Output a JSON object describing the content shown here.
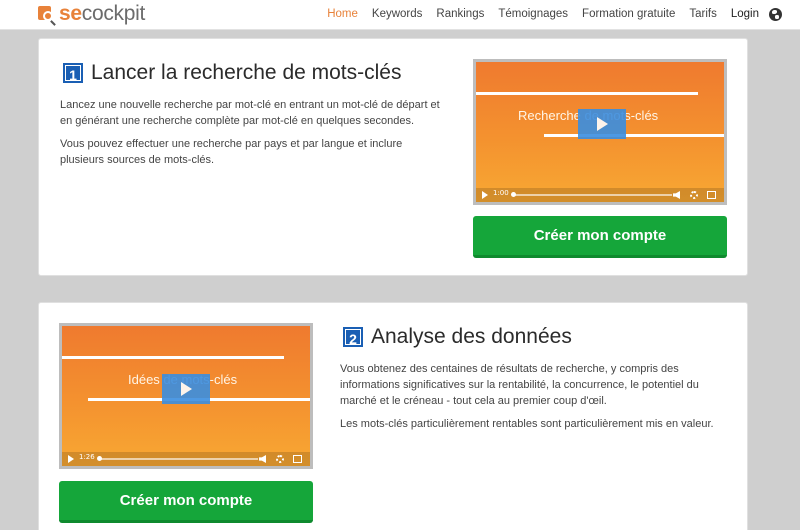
{
  "header": {
    "logo_se": "se",
    "logo_rest": "cockpit",
    "nav": [
      {
        "label": "Home"
      },
      {
        "label": "Keywords"
      },
      {
        "label": "Rankings"
      },
      {
        "label": "Témoignages"
      },
      {
        "label": "Formation gratuite"
      },
      {
        "label": "Tarifs"
      },
      {
        "label": "Login"
      }
    ],
    "language_icon": "globe-icon"
  },
  "section1": {
    "number": "1",
    "title": "Lancer la recherche de mots-clés",
    "paragraphs": [
      "Lancez une nouvelle recherche par mot-clé en entrant un mot-clé de départ et en générant une recherche complète par mot-clé en quelques secondes.",
      "Vous pouvez effectuer une recherche par pays et par langue et inclure plusieurs sources de mots-clés."
    ],
    "video": {
      "label": "Recherche de mots-clés",
      "duration": "1:00"
    },
    "cta": "Créer mon compte"
  },
  "section2": {
    "number": "2",
    "title": "Analyse des données",
    "paragraphs": [
      "Vous obtenez des centaines de résultats de recherche, y compris des informations significatives sur la rentabilité, la concurrence, le potentiel du marché et le créneau - tout cela au premier coup d'œil.",
      "Les mots-clés particulièrement rentables sont particulièrement mis en valeur."
    ],
    "video": {
      "label": "Idées de mots-clés",
      "duration": "1:26"
    },
    "cta": "Créer mon compte"
  },
  "colors": {
    "accent": "#e8823a",
    "cta": "#15a63a",
    "step_badge": "#1a5fb4"
  }
}
